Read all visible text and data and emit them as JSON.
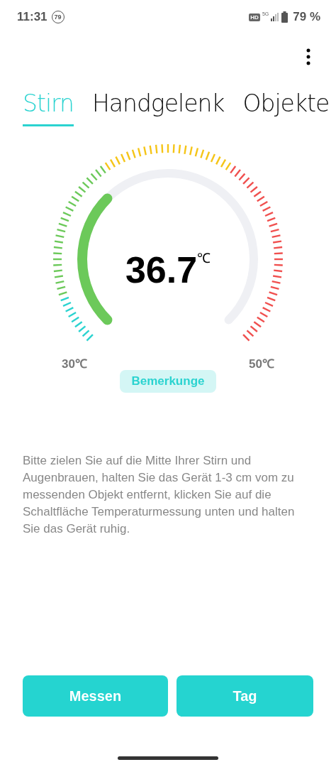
{
  "status_bar": {
    "time": "11:31",
    "notification_badge": "79",
    "network_badges": [
      "HD",
      "5G"
    ],
    "battery": "79 %"
  },
  "tabs": [
    {
      "label": "Stirn",
      "selected": true
    },
    {
      "label": "Handgelenk",
      "selected": false
    },
    {
      "label": "Objekte",
      "selected": false
    }
  ],
  "gauge": {
    "value": "36.7",
    "unit": "℃",
    "min_label": "30℃",
    "max_label": "50℃"
  },
  "remark_button": "Bemerkunge",
  "instructions": "Bitte zielen Sie auf die Mitte Ihrer Stirn und Augenbrauen, halten Sie das Gerät 1-3 cm vom zu messenden Objekt entfernt, klicken Sie auf die Schaltfläche Temperaturmessung unten und halten Sie das Gerät ruhig.",
  "buttons": [
    "Messen",
    "Tag"
  ]
}
